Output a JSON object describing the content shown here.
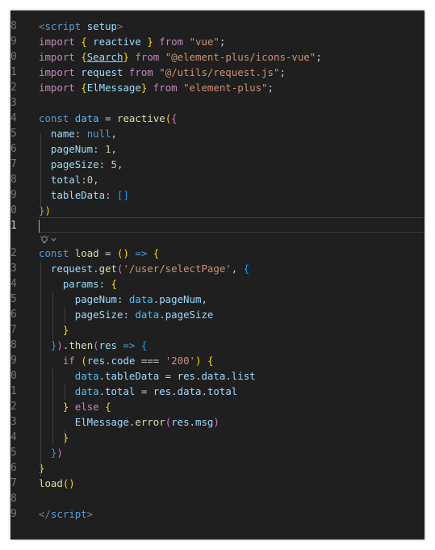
{
  "editor": {
    "colors": {
      "background": "#1f1f1f",
      "tag": "#808080",
      "tag_name": "#569cd6",
      "attribute": "#9cdcfe",
      "keyword_control": "#c586c0",
      "keyword_storage": "#569cd6",
      "variable": "#9cdcfe",
      "function": "#dcdcaa",
      "string": "#ce9178",
      "number": "#b5cea8",
      "component": "#4ec9b0",
      "bracket_gold": "#ffd700",
      "bracket_purple": "#da70d6",
      "bracket_blue": "#179fff",
      "plain": "#cccccc"
    },
    "code_action_icon": "lightbulb-sparkle-icon",
    "lines": [
      {
        "num": "8",
        "tokens": [
          {
            "t": "<",
            "c": "#808080"
          },
          {
            "t": "script",
            "c": "#569cd6"
          },
          {
            "t": " "
          },
          {
            "t": "setup",
            "c": "#9cdcfe"
          },
          {
            "t": ">",
            "c": "#808080"
          }
        ]
      },
      {
        "num": "9",
        "tokens": [
          {
            "t": "import",
            "c": "#c586c0"
          },
          {
            "t": " "
          },
          {
            "t": "{",
            "c": "#ffd700"
          },
          {
            "t": " "
          },
          {
            "t": "reactive",
            "c": "#9cdcfe"
          },
          {
            "t": " "
          },
          {
            "t": "}",
            "c": "#ffd700"
          },
          {
            "t": " "
          },
          {
            "t": "from",
            "c": "#c586c0"
          },
          {
            "t": " "
          },
          {
            "t": "\"vue\"",
            "c": "#ce9178"
          },
          {
            "t": ";"
          }
        ]
      },
      {
        "num": "0",
        "tokens": [
          {
            "t": "import",
            "c": "#c586c0"
          },
          {
            "t": " "
          },
          {
            "t": "{",
            "c": "#ffd700"
          },
          {
            "t": "Search",
            "c": "#9cdcfe",
            "u": true
          },
          {
            "t": "}",
            "c": "#ffd700"
          },
          {
            "t": " "
          },
          {
            "t": "from",
            "c": "#c586c0"
          },
          {
            "t": " "
          },
          {
            "t": "\"@element-plus/icons-vue\"",
            "c": "#ce9178"
          },
          {
            "t": ";"
          }
        ]
      },
      {
        "num": "1",
        "tokens": [
          {
            "t": "import",
            "c": "#c586c0"
          },
          {
            "t": " "
          },
          {
            "t": "request",
            "c": "#9cdcfe"
          },
          {
            "t": " "
          },
          {
            "t": "from",
            "c": "#c586c0"
          },
          {
            "t": " "
          },
          {
            "t": "\"@/utils/request.js\"",
            "c": "#ce9178"
          },
          {
            "t": ";"
          }
        ]
      },
      {
        "num": "2",
        "tokens": [
          {
            "t": "import",
            "c": "#c586c0"
          },
          {
            "t": " "
          },
          {
            "t": "{",
            "c": "#ffd700"
          },
          {
            "t": "ElMessage",
            "c": "#9cdcfe"
          },
          {
            "t": "}",
            "c": "#ffd700"
          },
          {
            "t": " "
          },
          {
            "t": "from",
            "c": "#c586c0"
          },
          {
            "t": " "
          },
          {
            "t": "\"element-plus\"",
            "c": "#ce9178"
          },
          {
            "t": ";"
          }
        ]
      },
      {
        "num": "3",
        "tokens": []
      },
      {
        "num": "4",
        "tokens": [
          {
            "t": "const",
            "c": "#569cd6"
          },
          {
            "t": " "
          },
          {
            "t": "data",
            "c": "#4fc1ff"
          },
          {
            "t": " = "
          },
          {
            "t": "reactive",
            "c": "#dcdcaa"
          },
          {
            "t": "(",
            "c": "#ffd700"
          },
          {
            "t": "{",
            "c": "#da70d6"
          }
        ]
      },
      {
        "num": "5",
        "tokens": [
          {
            "t": "  "
          },
          {
            "t": "name",
            "c": "#9cdcfe"
          },
          {
            "t": ": "
          },
          {
            "t": "null",
            "c": "#569cd6"
          },
          {
            "t": ","
          }
        ]
      },
      {
        "num": "6",
        "tokens": [
          {
            "t": "  "
          },
          {
            "t": "pageNum",
            "c": "#9cdcfe"
          },
          {
            "t": ": "
          },
          {
            "t": "1",
            "c": "#b5cea8"
          },
          {
            "t": ","
          }
        ]
      },
      {
        "num": "7",
        "tokens": [
          {
            "t": "  "
          },
          {
            "t": "pageSize",
            "c": "#9cdcfe"
          },
          {
            "t": ": "
          },
          {
            "t": "5",
            "c": "#b5cea8"
          },
          {
            "t": ","
          }
        ]
      },
      {
        "num": "8",
        "tokens": [
          {
            "t": "  "
          },
          {
            "t": "total",
            "c": "#9cdcfe"
          },
          {
            "t": ":"
          },
          {
            "t": "0",
            "c": "#b5cea8"
          },
          {
            "t": ","
          }
        ]
      },
      {
        "num": "9",
        "tokens": [
          {
            "t": "  "
          },
          {
            "t": "tableData",
            "c": "#9cdcfe"
          },
          {
            "t": ": "
          },
          {
            "t": "[]",
            "c": "#179fff"
          }
        ]
      },
      {
        "num": "0",
        "tokens": [
          {
            "t": "}",
            "c": "#da70d6"
          },
          {
            "t": ")",
            "c": "#ffd700"
          }
        ]
      },
      {
        "num": "1",
        "tokens": [],
        "current": true
      },
      {
        "num": "2",
        "tokens": [
          {
            "t": "const",
            "c": "#569cd6"
          },
          {
            "t": " "
          },
          {
            "t": "load",
            "c": "#dcdcaa"
          },
          {
            "t": " = "
          },
          {
            "t": "()",
            "c": "#ffd700"
          },
          {
            "t": " "
          },
          {
            "t": "=>",
            "c": "#569cd6"
          },
          {
            "t": " "
          },
          {
            "t": "{",
            "c": "#ffd700"
          }
        ]
      },
      {
        "num": "3",
        "tokens": [
          {
            "t": "  "
          },
          {
            "t": "request",
            "c": "#9cdcfe"
          },
          {
            "t": "."
          },
          {
            "t": "get",
            "c": "#dcdcaa"
          },
          {
            "t": "(",
            "c": "#da70d6"
          },
          {
            "t": "'/user/selectPage'",
            "c": "#ce9178"
          },
          {
            "t": ", "
          },
          {
            "t": "{",
            "c": "#179fff"
          }
        ]
      },
      {
        "num": "4",
        "tokens": [
          {
            "t": "    "
          },
          {
            "t": "params",
            "c": "#9cdcfe"
          },
          {
            "t": ": "
          },
          {
            "t": "{",
            "c": "#ffd700"
          }
        ]
      },
      {
        "num": "5",
        "tokens": [
          {
            "t": "      "
          },
          {
            "t": "pageNum",
            "c": "#9cdcfe"
          },
          {
            "t": ": "
          },
          {
            "t": "data",
            "c": "#4fc1ff"
          },
          {
            "t": "."
          },
          {
            "t": "pageNum",
            "c": "#9cdcfe"
          },
          {
            "t": ","
          }
        ]
      },
      {
        "num": "6",
        "tokens": [
          {
            "t": "      "
          },
          {
            "t": "pageSize",
            "c": "#9cdcfe"
          },
          {
            "t": ": "
          },
          {
            "t": "data",
            "c": "#4fc1ff"
          },
          {
            "t": "."
          },
          {
            "t": "pageSize",
            "c": "#9cdcfe"
          }
        ]
      },
      {
        "num": "7",
        "tokens": [
          {
            "t": "    "
          },
          {
            "t": "}",
            "c": "#ffd700"
          }
        ]
      },
      {
        "num": "8",
        "tokens": [
          {
            "t": "  "
          },
          {
            "t": "}",
            "c": "#179fff"
          },
          {
            "t": ")",
            "c": "#da70d6"
          },
          {
            "t": "."
          },
          {
            "t": "then",
            "c": "#dcdcaa"
          },
          {
            "t": "(",
            "c": "#da70d6"
          },
          {
            "t": "res",
            "c": "#9cdcfe"
          },
          {
            "t": " "
          },
          {
            "t": "=>",
            "c": "#569cd6"
          },
          {
            "t": " "
          },
          {
            "t": "{",
            "c": "#179fff"
          }
        ]
      },
      {
        "num": "9",
        "tokens": [
          {
            "t": "    "
          },
          {
            "t": "if",
            "c": "#c586c0"
          },
          {
            "t": " "
          },
          {
            "t": "(",
            "c": "#ffd700"
          },
          {
            "t": "res",
            "c": "#9cdcfe"
          },
          {
            "t": "."
          },
          {
            "t": "code",
            "c": "#9cdcfe"
          },
          {
            "t": " === "
          },
          {
            "t": "'200'",
            "c": "#ce9178"
          },
          {
            "t": ")",
            "c": "#ffd700"
          },
          {
            "t": " "
          },
          {
            "t": "{",
            "c": "#ffd700"
          }
        ]
      },
      {
        "num": "0",
        "tokens": [
          {
            "t": "      "
          },
          {
            "t": "data",
            "c": "#4fc1ff"
          },
          {
            "t": "."
          },
          {
            "t": "tableData",
            "c": "#9cdcfe"
          },
          {
            "t": " = "
          },
          {
            "t": "res",
            "c": "#9cdcfe"
          },
          {
            "t": "."
          },
          {
            "t": "data",
            "c": "#9cdcfe"
          },
          {
            "t": "."
          },
          {
            "t": "list",
            "c": "#9cdcfe"
          }
        ]
      },
      {
        "num": "1",
        "tokens": [
          {
            "t": "      "
          },
          {
            "t": "data",
            "c": "#4fc1ff"
          },
          {
            "t": "."
          },
          {
            "t": "total",
            "c": "#9cdcfe"
          },
          {
            "t": " = "
          },
          {
            "t": "res",
            "c": "#9cdcfe"
          },
          {
            "t": "."
          },
          {
            "t": "data",
            "c": "#9cdcfe"
          },
          {
            "t": "."
          },
          {
            "t": "total",
            "c": "#9cdcfe"
          }
        ]
      },
      {
        "num": "2",
        "tokens": [
          {
            "t": "    "
          },
          {
            "t": "}",
            "c": "#ffd700"
          },
          {
            "t": " "
          },
          {
            "t": "else",
            "c": "#c586c0"
          },
          {
            "t": " "
          },
          {
            "t": "{",
            "c": "#ffd700"
          }
        ]
      },
      {
        "num": "3",
        "tokens": [
          {
            "t": "      "
          },
          {
            "t": "ElMessage",
            "c": "#9cdcfe"
          },
          {
            "t": "."
          },
          {
            "t": "error",
            "c": "#dcdcaa"
          },
          {
            "t": "(",
            "c": "#da70d6"
          },
          {
            "t": "res",
            "c": "#9cdcfe"
          },
          {
            "t": "."
          },
          {
            "t": "msg",
            "c": "#9cdcfe"
          },
          {
            "t": ")",
            "c": "#da70d6"
          }
        ]
      },
      {
        "num": "4",
        "tokens": [
          {
            "t": "    "
          },
          {
            "t": "}",
            "c": "#ffd700"
          }
        ]
      },
      {
        "num": "5",
        "tokens": [
          {
            "t": "  "
          },
          {
            "t": "}",
            "c": "#179fff"
          },
          {
            "t": ")",
            "c": "#da70d6"
          }
        ]
      },
      {
        "num": "6",
        "tokens": [
          {
            "t": "}",
            "c": "#ffd700"
          }
        ]
      },
      {
        "num": "7",
        "tokens": [
          {
            "t": "load",
            "c": "#dcdcaa"
          },
          {
            "t": "()",
            "c": "#ffd700"
          }
        ]
      },
      {
        "num": "8",
        "tokens": []
      },
      {
        "num": "9",
        "tokens": [
          {
            "t": "</",
            "c": "#808080"
          },
          {
            "t": "script",
            "c": "#569cd6"
          },
          {
            "t": ">",
            "c": "#808080"
          }
        ]
      }
    ]
  }
}
